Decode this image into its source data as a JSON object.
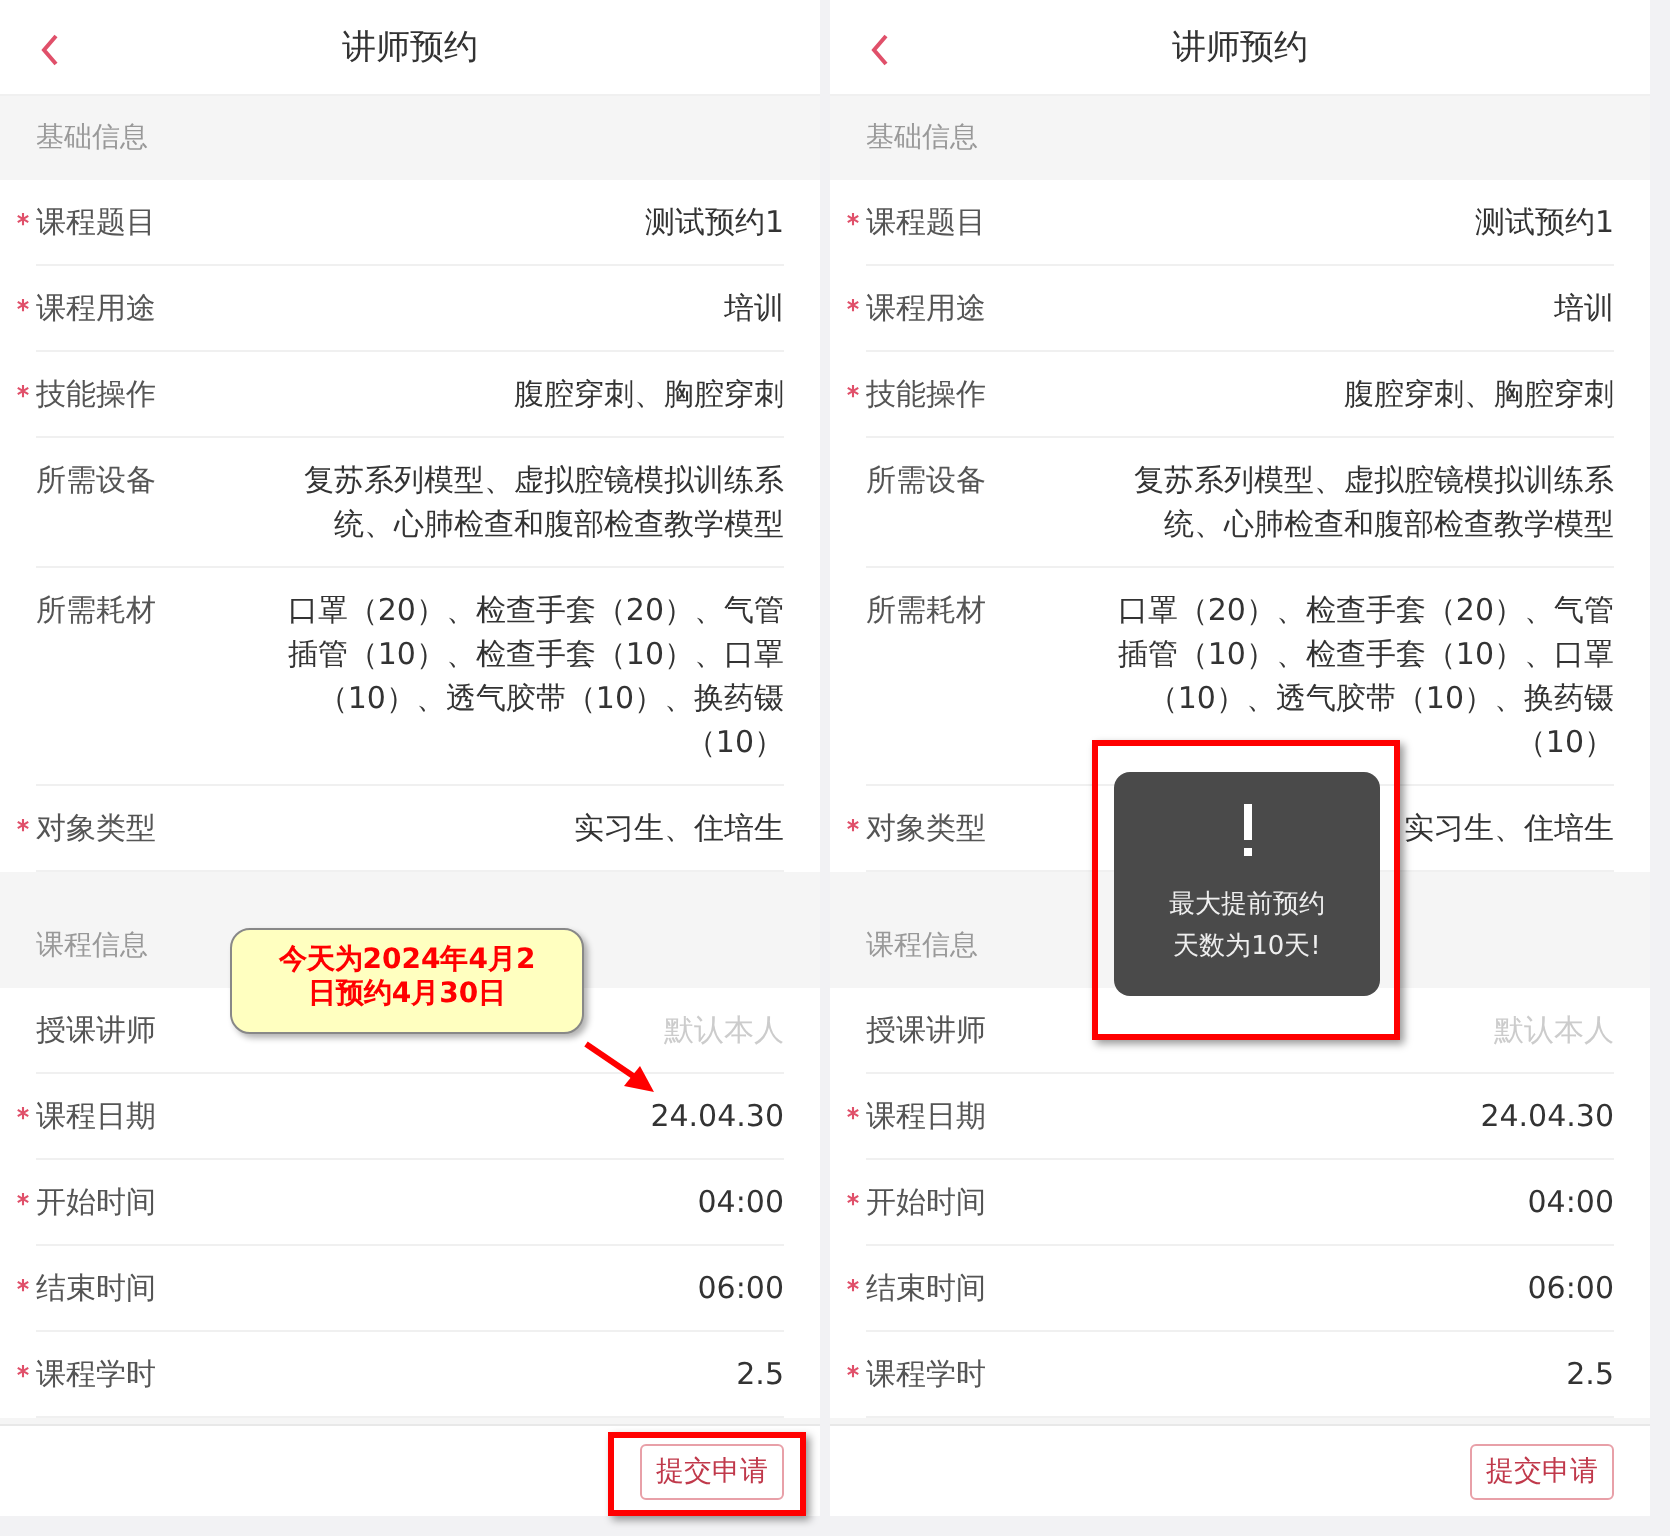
{
  "screens": [
    {
      "title": "讲师预约",
      "sections": [
        {
          "heading": "基础信息",
          "fields": [
            {
              "label": "课程题目",
              "required": true,
              "value": "测试预约1"
            },
            {
              "label": "课程用途",
              "required": true,
              "value": "培训"
            },
            {
              "label": "技能操作",
              "required": true,
              "value": "腹腔穿刺、胸腔穿刺"
            },
            {
              "label": "所需设备",
              "required": false,
              "value": "复苏系列模型、虚拟腔镜模拟训练系统、心肺检查和腹部检查教学模型"
            },
            {
              "label": "所需耗材",
              "required": false,
              "value": "口罩（20）、检查手套（20）、气管插管（10）、检查手套（10）、口罩（10）、透气胶带（10）、换药镊（10）"
            },
            {
              "label": "对象类型",
              "required": true,
              "value": "实习生、住培生"
            }
          ]
        },
        {
          "heading": "课程信息",
          "fields": [
            {
              "label": "授课讲师",
              "required": false,
              "placeholder": "默认本人"
            },
            {
              "label": "课程日期",
              "required": true,
              "value": "24.04.30"
            },
            {
              "label": "开始时间",
              "required": true,
              "value": "04:00"
            },
            {
              "label": "结束时间",
              "required": true,
              "value": "06:00"
            },
            {
              "label": "课程学时",
              "required": true,
              "value": "2.5"
            }
          ]
        }
      ],
      "submit_button": "提交申请",
      "annotations": [
        {
          "kind": "callout",
          "text": "今天为2024年4月2日预约4月30日"
        },
        {
          "kind": "arrow"
        },
        {
          "kind": "submit_highlight"
        }
      ]
    },
    {
      "title": "讲师预约",
      "sections": [
        {
          "heading": "基础信息",
          "fields": [
            {
              "label": "课程题目",
              "required": true,
              "value": "测试预约1"
            },
            {
              "label": "课程用途",
              "required": true,
              "value": "培训"
            },
            {
              "label": "技能操作",
              "required": true,
              "value": "腹腔穿刺、胸腔穿刺"
            },
            {
              "label": "所需设备",
              "required": false,
              "value": "复苏系列模型、虚拟腔镜模拟训练系统、心肺检查和腹部检查教学模型"
            },
            {
              "label": "所需耗材",
              "required": false,
              "value": "口罩（20）、检查手套（20）、气管插管（10）、检查手套（10）、口罩（10）、透气胶带（10）、换药镊（10）"
            },
            {
              "label": "对象类型",
              "required": true,
              "value": "实习生、住培生"
            }
          ]
        },
        {
          "heading": "课程信息",
          "fields": [
            {
              "label": "授课讲师",
              "required": false,
              "placeholder": "默认本人"
            },
            {
              "label": "课程日期",
              "required": true,
              "value": "24.04.30"
            },
            {
              "label": "开始时间",
              "required": true,
              "value": "04:00"
            },
            {
              "label": "结束时间",
              "required": true,
              "value": "06:00"
            },
            {
              "label": "课程学时",
              "required": true,
              "value": "2.5"
            }
          ]
        }
      ],
      "submit_button": "提交申请",
      "toast": {
        "message": "最大提前预约天数为10天!"
      },
      "annotations": [
        {
          "kind": "toast_highlight"
        }
      ]
    }
  ]
}
